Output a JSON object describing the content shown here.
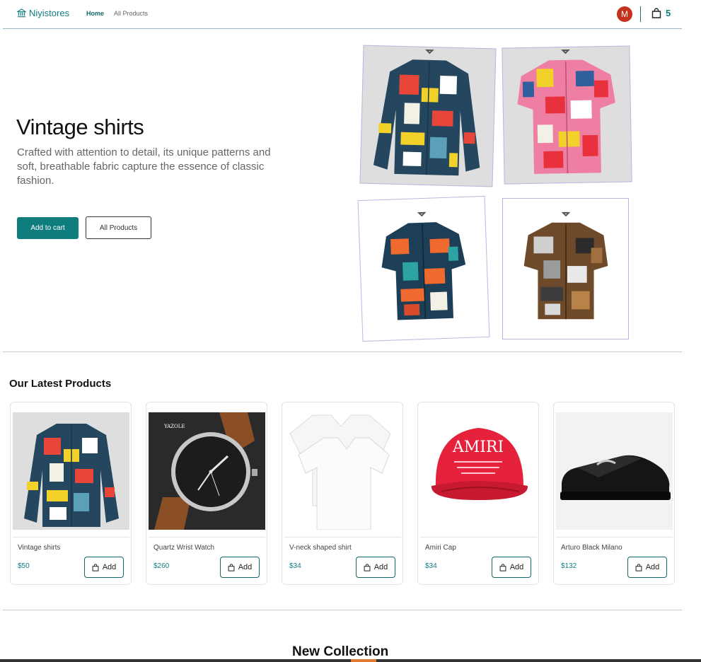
{
  "header": {
    "brand": "Niyistores",
    "nav": [
      "Home",
      "All Products"
    ],
    "avatar_initial": "M",
    "cart_count": "5"
  },
  "hero": {
    "title": "Vintage shirts",
    "description": "Crafted with attention to detail, its unique patterns and soft, breathable fabric capture the essence of classic fashion.",
    "primary_button": "Add to cart",
    "secondary_button": "All Products"
  },
  "latest": {
    "title": "Our Latest Products",
    "add_label": "Add",
    "products": [
      {
        "name": "Vintage shirts",
        "price": "$50"
      },
      {
        "name": "Quartz Wrist Watch",
        "price": "$260"
      },
      {
        "name": "V-neck shaped shirt",
        "price": "$34"
      },
      {
        "name": "Amiri Cap",
        "price": "$34"
      },
      {
        "name": "Arturo Black Milano",
        "price": "$132"
      }
    ]
  },
  "new_collection": {
    "title": "New Collection"
  },
  "images": {
    "watch_brand": "YAZOLE",
    "cap_brand": "AMIRI"
  },
  "colors": {
    "accent": "#0f7d7d",
    "avatar": "#c4321d"
  }
}
